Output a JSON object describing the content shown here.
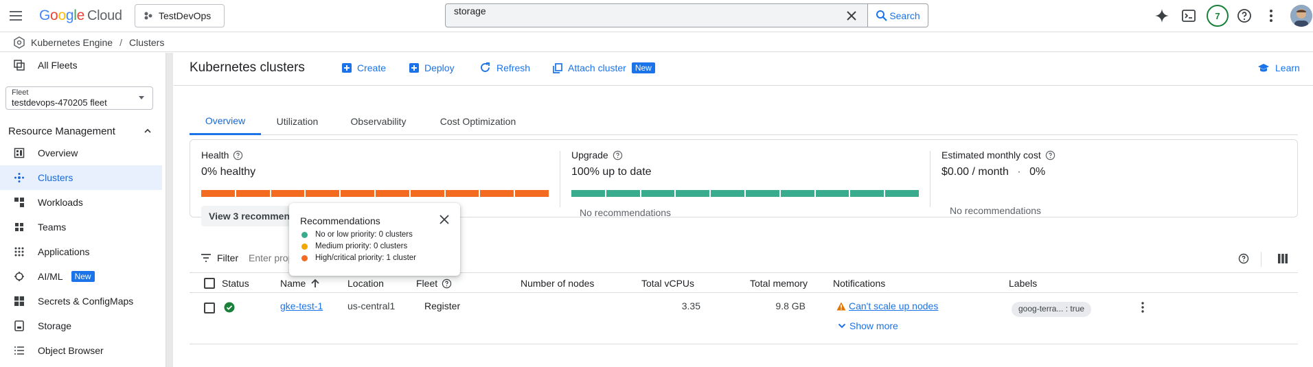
{
  "colors": {
    "accent": "#1a73e8",
    "health_bar": "#f26b21",
    "upgrade_bar": "#3aac8e",
    "priority_low": "#3aac8e",
    "priority_medium": "#f2a600",
    "priority_high": "#f26b21",
    "status_ok": "#188038",
    "warning": "#e37400"
  },
  "topbar": {
    "logo_google": "Google",
    "logo_cloud": "Cloud",
    "project": "TestDevOps",
    "search_value": "storage",
    "search_button": "Search",
    "notification_count": "7"
  },
  "breadcrumb": {
    "root": "Kubernetes Engine",
    "current": "Clusters"
  },
  "sidebar": {
    "all_fleets": "All Fleets",
    "fleet_label": "Fleet",
    "fleet_value": "testdevops-470205 fleet",
    "section": "Resource Management",
    "items": [
      {
        "label": "Overview",
        "icon": "dashboard-icon"
      },
      {
        "label": "Clusters",
        "icon": "clusters-icon",
        "active": true
      },
      {
        "label": "Workloads",
        "icon": "workloads-icon"
      },
      {
        "label": "Teams",
        "icon": "teams-icon"
      },
      {
        "label": "Applications",
        "icon": "apps-grid-icon"
      },
      {
        "label": "AI/ML",
        "icon": "ai-ml-icon",
        "badge": "New"
      },
      {
        "label": "Secrets & ConfigMaps",
        "icon": "secrets-icon"
      },
      {
        "label": "Storage",
        "icon": "storage-icon"
      },
      {
        "label": "Object Browser",
        "icon": "object-browser-icon"
      }
    ]
  },
  "header": {
    "title": "Kubernetes clusters",
    "create": "Create",
    "deploy": "Deploy",
    "refresh": "Refresh",
    "attach": "Attach cluster",
    "attach_badge": "New",
    "learn": "Learn"
  },
  "tabs": [
    "Overview",
    "Utilization",
    "Observability",
    "Cost Optimization"
  ],
  "metrics": {
    "health": {
      "title": "Health",
      "value": "0% healthy",
      "segments": 10,
      "healthy_fraction": 0,
      "button": "View 3 recommendations"
    },
    "upgrade": {
      "title": "Upgrade",
      "value": "100% up to date",
      "segments": 10,
      "up_to_date_fraction": 1.0,
      "note": "No recommendations"
    },
    "cost": {
      "title": "Estimated monthly cost",
      "value": "$0.00 / month",
      "sep": "·",
      "pct": "0%",
      "note": "No recommendations"
    }
  },
  "filter": {
    "label": "Filter",
    "placeholder": "Enter property name or value"
  },
  "table": {
    "columns": {
      "status": "Status",
      "name": "Name",
      "location": "Location",
      "fleet": "Fleet",
      "nodes": "Number of nodes",
      "vcpus": "Total vCPUs",
      "memory": "Total memory",
      "notifications": "Notifications",
      "labels": "Labels"
    },
    "rows": [
      {
        "name": "gke-test-1",
        "location": "us-central1",
        "fleet": "Register",
        "nodes": "",
        "vcpus": "3.35",
        "memory": "9.8 GB",
        "notification": "Can't scale up nodes",
        "show_more": "Show more",
        "label": "goog-terra... : true"
      }
    ]
  },
  "popover": {
    "title": "Recommendations",
    "items": [
      {
        "text": "No or low priority: 0 clusters",
        "color": "#3aac8e"
      },
      {
        "text": "Medium priority: 0 clusters",
        "color": "#f2a600"
      },
      {
        "text": "High/critical priority: 1 cluster",
        "color": "#f26b21"
      }
    ]
  }
}
